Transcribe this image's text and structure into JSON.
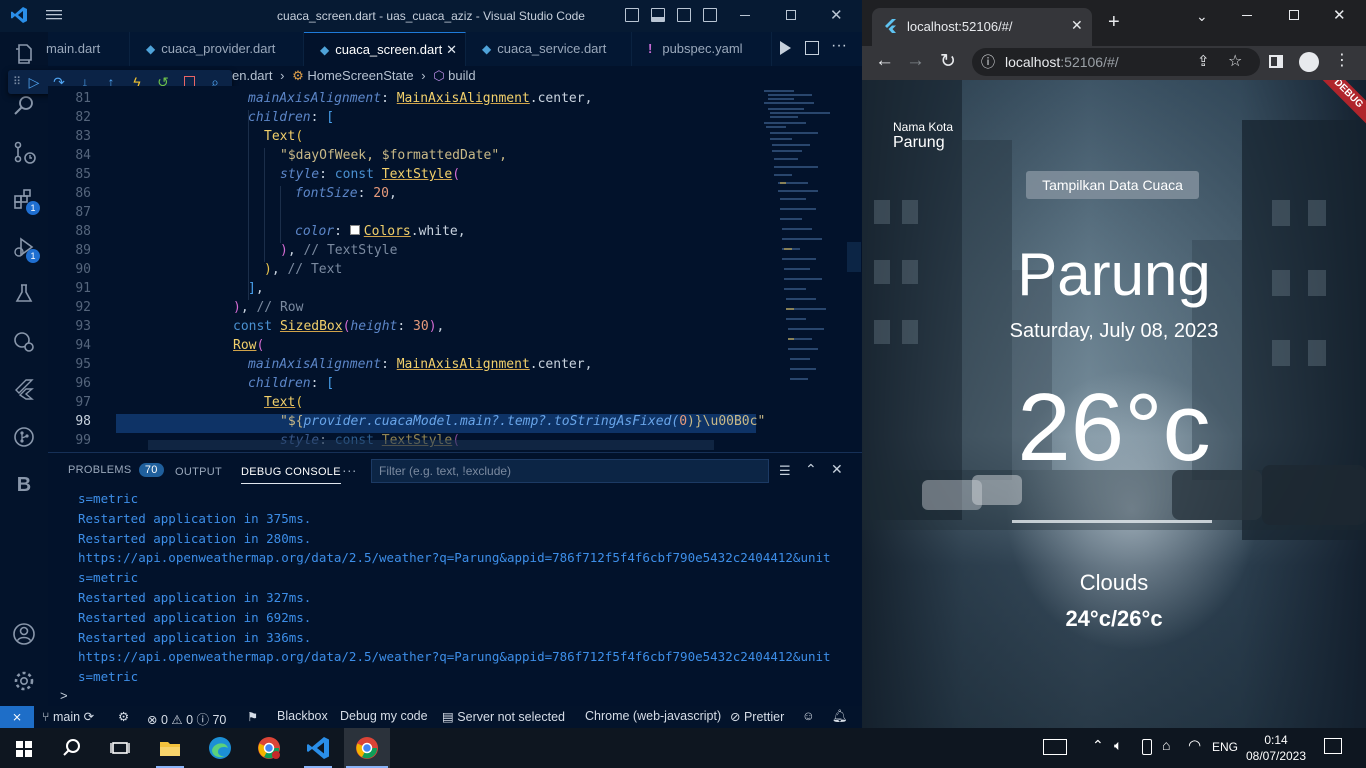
{
  "vscode": {
    "title": "cuaca_screen.dart - uas_cuaca_aziz - Visual Studio Code",
    "tabs": [
      {
        "label": "main.dart",
        "icon": "dart-icon",
        "active": false
      },
      {
        "label": "cuaca_provider.dart",
        "icon": "dart-icon",
        "active": false
      },
      {
        "label": "cuaca_screen.dart",
        "icon": "dart-icon",
        "active": true
      },
      {
        "label": "cuaca_service.dart",
        "icon": "dart-icon",
        "active": false
      },
      {
        "label": "pubspec.yaml",
        "icon": "yaml-icon",
        "active": false
      }
    ],
    "tab_shown_labels": [
      "main.dart",
      "cuaca_provider.dart",
      "cuaca_screen.dart",
      "cuaca_service.dart",
      "pubspec.yaml"
    ],
    "breadcrumb": {
      "file": "en.dart",
      "cls": "HomeScreenState",
      "method": "build"
    },
    "line_numbers": [
      "81",
      "82",
      "83",
      "84",
      "85",
      "86",
      "87",
      "88",
      "89",
      "90",
      "91",
      "92",
      "93",
      "94",
      "95",
      "96",
      "97",
      "98",
      "99"
    ],
    "code": {
      "l81a": "mainAxisAlignment",
      "l81b": "MainAxisAlignment",
      "l81c": ".center,",
      "l82": "children",
      "l83": "Text",
      "l84": "\"$dayOfWeek, $formattedDate\",",
      "l85a": "style",
      "l85b": "const",
      "l85c": "TextStyle",
      "l86a": "fontSize",
      "l86b": "20",
      "l88a": "color",
      "l88b": "Colors",
      "l88c": ".white,",
      "l89": "// TextStyle",
      "l90": "// Text",
      "l92": "// Row",
      "l93a": "const",
      "l93b": "SizedBox",
      "l93c": "height",
      "l93d": "30",
      "l94": "Row",
      "l95a": "mainAxisAlignment",
      "l95b": "MainAxisAlignment",
      "l95c": ".center,",
      "l96": "children",
      "l97": "Text",
      "l98a": "\"${",
      "l98b": "provider",
      "l98c": ".cuacaModel.main?.temp?.toStringAsFixed(",
      "l98d": "0",
      "l98e": ")}\\u00B0c\"",
      "l99a": "style",
      "l99b": "const",
      "l99c": "TextStyle"
    },
    "panel": {
      "tabs": {
        "problems": "PROBLEMS",
        "problems_count": "70",
        "output": "OUTPUT",
        "debug": "DEBUG CONSOLE",
        "more": "···"
      },
      "filter_placeholder": "Filter (e.g. text, !exclude)",
      "console_lines": [
        "s=metric",
        "Restarted application in 375ms.",
        "Restarted application in 280ms.",
        "https://api.openweathermap.org/data/2.5/weather?q=Parung&appid=786f712f5f4f6cbf790e5432c2404412&unit",
        "s=metric",
        "Restarted application in 327ms.",
        "Restarted application in 692ms.",
        "Restarted application in 336ms.",
        "https://api.openweathermap.org/data/2.5/weather?q=Parung&appid=786f712f5f4f6cbf790e5432c2404412&unit",
        "s=metric"
      ],
      "prompt": ">"
    },
    "status": {
      "branch": "main",
      "errors": "0",
      "warnings": "0",
      "infos": "70",
      "blackbox": "Blackbox",
      "debug_code": "Debug my code",
      "server": "Server not selected",
      "device": "Chrome (web-javascript)",
      "prettier": "Prettier"
    },
    "activity_badges": {
      "extensions": "1",
      "debug": "1"
    }
  },
  "chrome": {
    "tab_title": "localhost:52106/#/",
    "url_host": "localhost",
    "url_rest": ":52106/#/",
    "debug_banner": "DEBUG",
    "app": {
      "city_label": "Nama Kota",
      "city_value": "Parung",
      "button": "Tampilkan Data Cuaca",
      "city_big": "Parung",
      "date": "Saturday, July 08, 2023",
      "temp": "26°c",
      "condition": "Clouds",
      "range": "24°c/26°c"
    }
  },
  "taskbar": {
    "lang": "ENG",
    "time": "0:14",
    "date": "08/07/2023"
  },
  "colors": {
    "accent": "#1e7ad9",
    "console_text": "#3d8ee8",
    "vscode_bg": "#02122b"
  }
}
